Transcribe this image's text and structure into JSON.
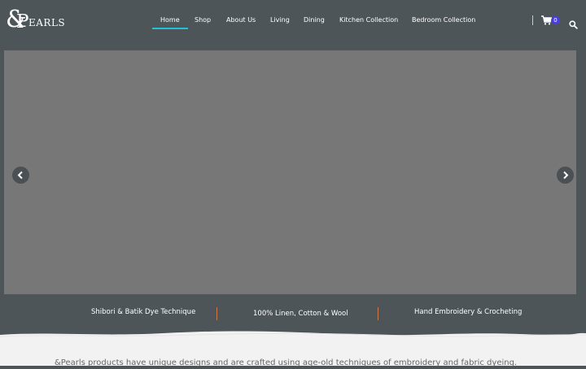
{
  "brand": {
    "logo_amp": "&",
    "logo_p": "P",
    "logo_rest": "EARLS"
  },
  "nav": {
    "items": [
      {
        "label": "Home"
      },
      {
        "label": "Shop"
      },
      {
        "label": "About Us"
      },
      {
        "label": "Living"
      },
      {
        "label": "Dining"
      },
      {
        "label": "Kitchen Collection"
      },
      {
        "label": "Bedroom Collection"
      }
    ],
    "active": "Home",
    "accent_color": "#23c1d8"
  },
  "cart": {
    "count": "0",
    "icon": "cart-icon",
    "badge_color": "#4a3fdc"
  },
  "search": {
    "icon": "search-icon"
  },
  "slider": {
    "prev_icon": "chevron-left-icon",
    "next_icon": "chevron-right-icon"
  },
  "features": [
    {
      "label": "Shibori & Batik Dye Technique"
    },
    {
      "label": "100% Linen, Cotton & Wool"
    },
    {
      "label": "Hand Embroidery & Crocheting"
    }
  ],
  "intro": {
    "text": "&Pearls products have unique designs and are crafted using age-old techniques of embroidery and fabric dyeing."
  },
  "colors": {
    "header_bg": "#4d5559",
    "hero_bg": "#777777",
    "separator": "#c97a4d"
  }
}
